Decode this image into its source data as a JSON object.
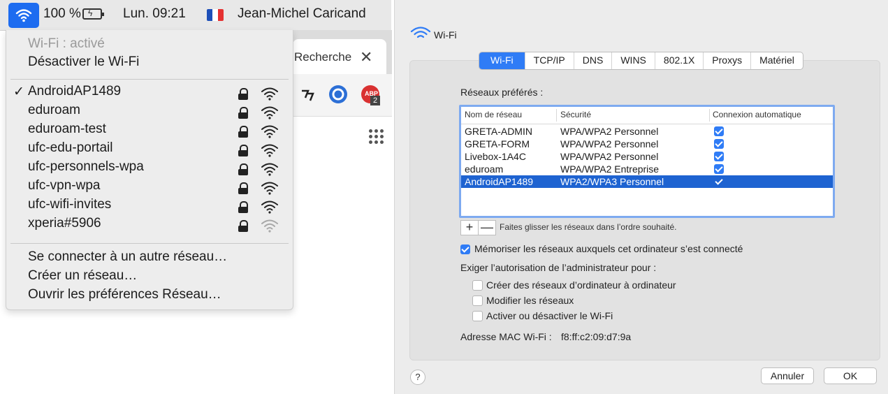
{
  "menubar": {
    "battery_text": "100 %",
    "clock": "Lun. 09:21",
    "user": "Jean-Michel Caricand"
  },
  "browser": {
    "tab_title": "Recherche",
    "tab_close": "✕",
    "badge_count": "2"
  },
  "wifi_menu": {
    "status": "Wi-Fi : activé",
    "toggle_label": "Désactiver le Wi-Fi",
    "networks": [
      {
        "name": "AndroidAP1489",
        "checked": true
      },
      {
        "name": "eduroam"
      },
      {
        "name": "eduroam-test"
      },
      {
        "name": "ufc-edu-portail"
      },
      {
        "name": "ufc-personnels-wpa"
      },
      {
        "name": "ufc-vpn-wpa"
      },
      {
        "name": "ufc-wifi-invites"
      },
      {
        "name": "xperia#5906"
      }
    ],
    "check_mark": "✓",
    "other_network": "Se connecter à un autre réseau…",
    "create_network": "Créer un réseau…",
    "open_prefs": "Ouvrir les préférences Réseau…"
  },
  "prefs": {
    "title": "Wi-Fi",
    "tabs": [
      "Wi-Fi",
      "TCP/IP",
      "DNS",
      "WINS",
      "802.1X",
      "Proxys",
      "Matériel"
    ],
    "active_tab": "Wi-Fi",
    "preferred_label": "Réseaux préférés :",
    "table_headers": [
      "Nom de réseau",
      "Sécurité",
      "Connexion automatique"
    ],
    "table_rows": [
      {
        "name": "GRETA-ADMIN",
        "security": "WPA/WPA2 Personnel",
        "auto": true
      },
      {
        "name": "GRETA-FORM",
        "security": "WPA/WPA2 Personnel",
        "auto": true
      },
      {
        "name": "Livebox-1A4C",
        "security": "WPA/WPA2 Personnel",
        "auto": true
      },
      {
        "name": "eduroam",
        "security": "WPA/WPA2 Entreprise",
        "auto": true
      },
      {
        "name": "AndroidAP1489",
        "security": "WPA2/WPA3 Personnel",
        "auto": true,
        "selected": true
      }
    ],
    "add_label": "+",
    "remove_label": "—",
    "drag_hint": "Faites glisser les réseaux dans l’ordre souhaité.",
    "remember_label": "Mémoriser les réseaux auxquels cet ordinateur s’est connecté",
    "admin_label": "Exiger l’autorisation de l’administrateur pour :",
    "admin_options": [
      "Créer des réseaux d’ordinateur à ordinateur",
      "Modifier les réseaux",
      "Activer ou désactiver le Wi-Fi"
    ],
    "mac_label": "Adresse MAC Wi-Fi :",
    "mac_value": "f8:ff:c2:09:d7:9a",
    "help_label": "?",
    "cancel_label": "Annuler",
    "ok_label": "OK"
  },
  "colors": {
    "accent": "#2f7cf6",
    "selection": "#1e63d1",
    "menubar_highlight": "#1d6cf0"
  }
}
